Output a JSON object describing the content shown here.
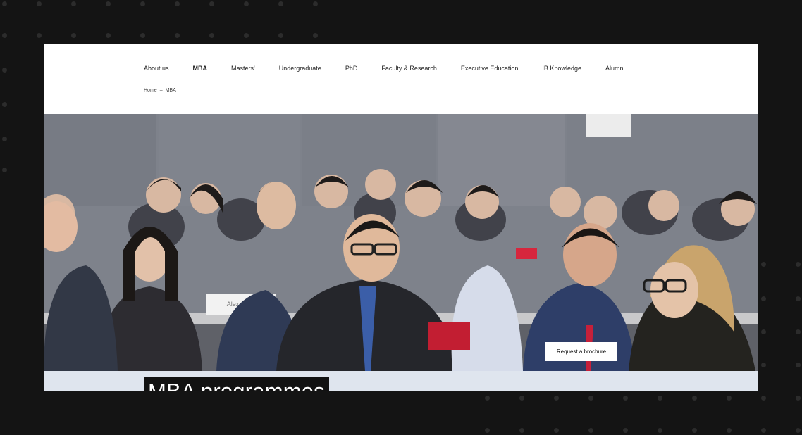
{
  "nav": {
    "items": [
      {
        "label": "About us",
        "active": false
      },
      {
        "label": "MBA",
        "active": true
      },
      {
        "label": "Masters'",
        "active": false
      },
      {
        "label": "Undergraduate",
        "active": false
      },
      {
        "label": "PhD",
        "active": false
      },
      {
        "label": "Faculty & Research",
        "active": false
      },
      {
        "label": "Executive Education",
        "active": false
      },
      {
        "label": "IB Knowledge",
        "active": false
      },
      {
        "label": "Alumni",
        "active": false
      }
    ]
  },
  "breadcrumb": {
    "home": "Home",
    "separator": "–",
    "current": "MBA"
  },
  "hero": {
    "title": "MBA programmes",
    "cta_label": "Request a brochure",
    "name_card": "Alexander"
  },
  "colors": {
    "accent": "#d7263d",
    "page_bg": "#141414",
    "bar": "#dfe5ee"
  }
}
